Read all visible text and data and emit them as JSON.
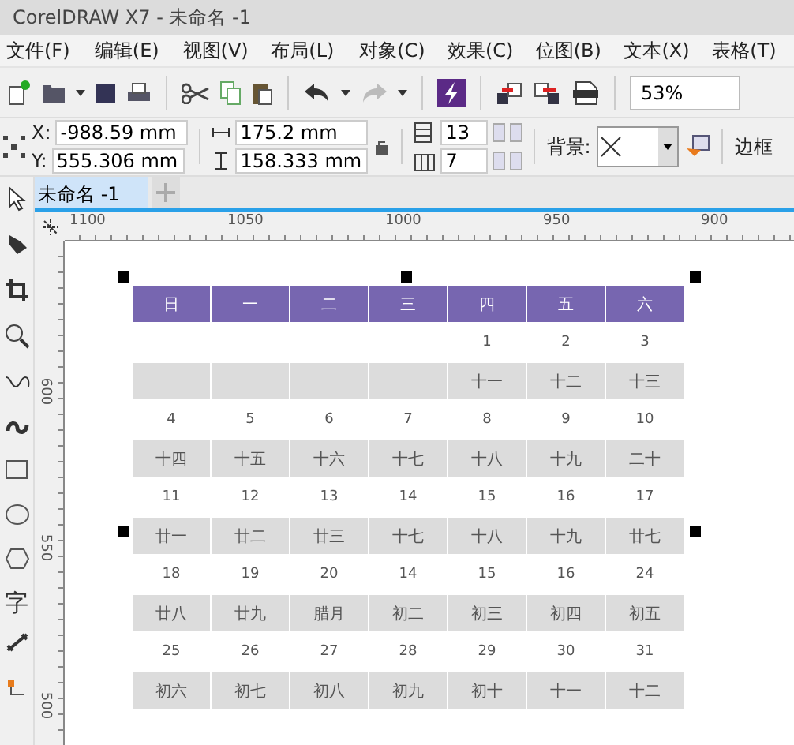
{
  "window": {
    "title": "CorelDRAW X7 - 未命名 -1"
  },
  "menu": [
    "文件(F)",
    "编辑(E)",
    "视图(V)",
    "布局(L)",
    "对象(C)",
    "效果(C)",
    "位图(B)",
    "文本(X)",
    "表格(T)"
  ],
  "toolbar": {
    "zoom": "53%"
  },
  "properties": {
    "x_label": "X:",
    "x": "-988.59 mm",
    "y_label": "Y:",
    "y": "555.306 mm",
    "width": "175.2 mm",
    "height": "158.333 mm",
    "rows": "13",
    "columns": "7",
    "background_label": "背景:",
    "border_label": "边框"
  },
  "toolbox": [
    {
      "kind": "pick"
    },
    {
      "kind": "shape"
    },
    {
      "kind": "crop"
    },
    {
      "kind": "zoom"
    },
    {
      "kind": "freehand"
    },
    {
      "kind": "artistic"
    },
    {
      "kind": "rectangle"
    },
    {
      "kind": "ellipse"
    },
    {
      "kind": "polygon"
    },
    {
      "kind": "text",
      "label": "字"
    },
    {
      "kind": "dimension"
    },
    {
      "kind": "connector"
    }
  ],
  "document_tabs": [
    {
      "label": "未命名 -1",
      "selected": true
    }
  ],
  "rulers": {
    "horizontal": [
      "1100",
      "1050",
      "1000",
      "950",
      "900"
    ],
    "vertical": [
      "600",
      "550",
      "500"
    ]
  },
  "calendar": {
    "header": [
      "日",
      "一",
      "二",
      "三",
      "四",
      "五",
      "六"
    ],
    "weeks": [
      {
        "cells": [
          {
            "kind": "blank"
          },
          {
            "kind": "blank"
          },
          {
            "kind": "blank"
          },
          {
            "kind": "blank"
          }
        ],
        "dates": [
          "1",
          "2",
          "3"
        ],
        "lunar": [
          "十一",
          "十二",
          "十三"
        ]
      },
      {
        "dates": [
          "4",
          "5",
          "6",
          "7",
          "8",
          "9",
          "10"
        ],
        "lunar": [
          "十四",
          "十五",
          "十六",
          "十七",
          "十八",
          "十九",
          "二十"
        ]
      },
      {
        "dates": [
          "11",
          "12",
          "13",
          "14",
          "15",
          "16",
          "17"
        ],
        "lunar": [
          "廿一",
          "廿二",
          "廿三",
          "十七",
          "十八",
          "十九",
          "廿七"
        ]
      },
      {
        "dates": [
          "18",
          "19",
          "20",
          "14",
          "15",
          "16",
          "24"
        ],
        "lunar": [
          "廿八",
          "廿九",
          "腊月",
          "初二",
          "初三",
          "初四",
          "初五"
        ]
      },
      {
        "dates": [
          "25",
          "26",
          "27",
          "28",
          "29",
          "30",
          "31"
        ],
        "lunar": [
          "初六",
          "初七",
          "初八",
          "初九",
          "初十",
          "十一",
          "十二"
        ]
      }
    ]
  }
}
